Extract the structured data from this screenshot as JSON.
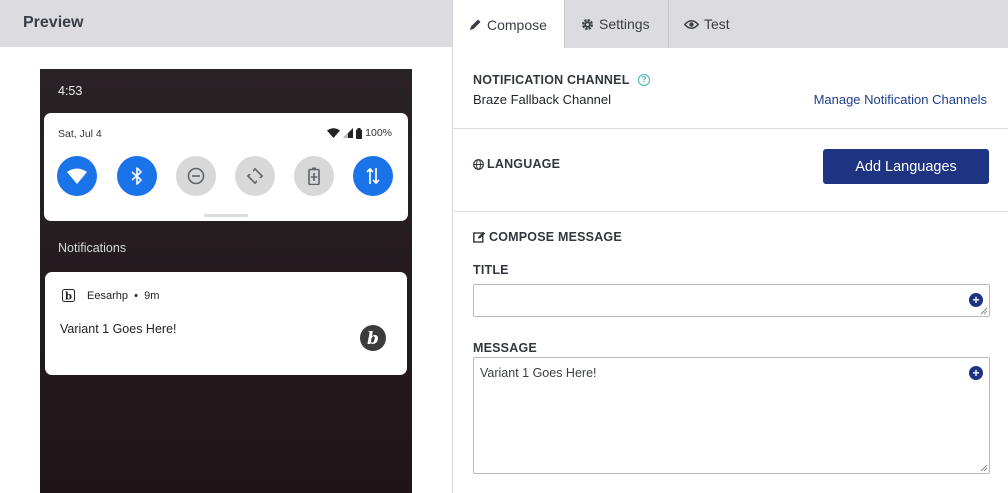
{
  "preview": {
    "title": "Preview"
  },
  "phone": {
    "time": "4:53",
    "quick_settings": {
      "date": "Sat, Jul 4",
      "battery": "100%",
      "tiles": [
        {
          "icon": "wifi-icon",
          "state": "on"
        },
        {
          "icon": "bluetooth-icon",
          "state": "on"
        },
        {
          "icon": "do-not-disturb-icon",
          "state": "off"
        },
        {
          "icon": "auto-rotate-icon",
          "state": "off"
        },
        {
          "icon": "battery-saver-icon",
          "state": "off"
        },
        {
          "icon": "mobile-data-icon",
          "state": "on"
        }
      ]
    },
    "notifications_label": "Notifications",
    "notification": {
      "app_name": "Eesarhp",
      "age": "9m",
      "text": "Variant 1 Goes Here!"
    }
  },
  "tabs": [
    {
      "label": "Compose",
      "icon": "pencil-icon",
      "active": true
    },
    {
      "label": "Settings",
      "icon": "gear-icon",
      "active": false
    },
    {
      "label": "Test",
      "icon": "eye-icon",
      "active": false
    }
  ],
  "channel": {
    "label": "NOTIFICATION CHANNEL",
    "help": "?",
    "value": "Braze Fallback Channel",
    "manage_link": "Manage Notification Channels"
  },
  "language": {
    "label": "LANGUAGE",
    "button": "Add Languages"
  },
  "compose": {
    "label": "COMPOSE MESSAGE",
    "title_label": "TITLE",
    "title_value": "",
    "message_label": "MESSAGE",
    "message_value": "Variant 1 Goes Here!"
  },
  "colors": {
    "accent": "#1e3381",
    "android_blue": "#1a73e8",
    "header_gray": "#dcdce0",
    "help_teal": "#3ab5b0"
  }
}
